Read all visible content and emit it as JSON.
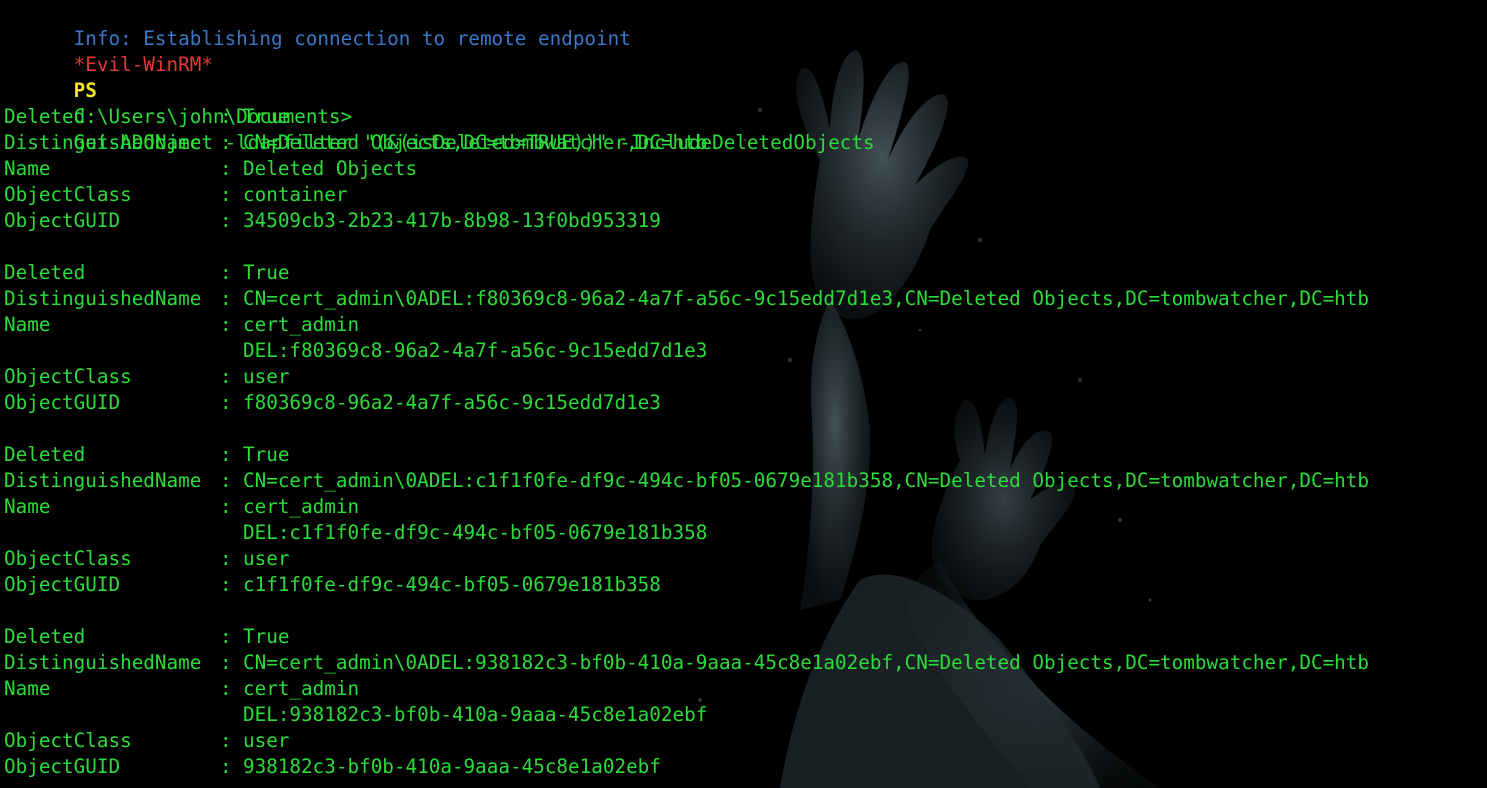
{
  "terminal": {
    "info_line": "Info: Establishing connection to remote endpoint",
    "prompt": {
      "shell_tag": "*Evil-WinRM*",
      "ps": "PS",
      "path": "C:\\Users\\john\\Documents>",
      "command": "Get-ADObject -ldapfilter \"(&(isDeleted=TRUE))\" -IncludeDeletedObjects"
    },
    "separator": ":",
    "labels": {
      "deleted": "Deleted",
      "dn": "DistinguishedName",
      "name": "Name",
      "class": "ObjectClass",
      "guid": "ObjectGUID"
    },
    "records": [
      {
        "deleted": "True",
        "dn": "CN=Deleted Objects,DC=tombwatcher,DC=htb",
        "name": "Deleted Objects",
        "name_cont": "",
        "class": "container",
        "guid": "34509cb3-2b23-417b-8b98-13f0bd953319"
      },
      {
        "deleted": "True",
        "dn": "CN=cert_admin\\0ADEL:f80369c8-96a2-4a7f-a56c-9c15edd7d1e3,CN=Deleted Objects,DC=tombwatcher,DC=htb",
        "name": "cert_admin",
        "name_cont": "DEL:f80369c8-96a2-4a7f-a56c-9c15edd7d1e3",
        "class": "user",
        "guid": "f80369c8-96a2-4a7f-a56c-9c15edd7d1e3"
      },
      {
        "deleted": "True",
        "dn": "CN=cert_admin\\0ADEL:c1f1f0fe-df9c-494c-bf05-0679e181b358,CN=Deleted Objects,DC=tombwatcher,DC=htb",
        "name": "cert_admin",
        "name_cont": "DEL:c1f1f0fe-df9c-494c-bf05-0679e181b358",
        "class": "user",
        "guid": "c1f1f0fe-df9c-494c-bf05-0679e181b358"
      },
      {
        "deleted": "True",
        "dn": "CN=cert_admin\\0ADEL:938182c3-bf0b-410a-9aaa-45c8e1a02ebf,CN=Deleted Objects,DC=tombwatcher,DC=htb",
        "name": "cert_admin",
        "name_cont": "DEL:938182c3-bf0b-410a-9aaa-45c8e1a02ebf",
        "class": "user",
        "guid": "938182c3-bf0b-410a-9aaa-45c8e1a02ebf"
      }
    ]
  },
  "colors": {
    "background": "#000000",
    "output_green": "#2bdc3a",
    "info_blue": "#3b78c9",
    "evil_red": "#e53935",
    "ps_yellow": "#f5e62a"
  }
}
